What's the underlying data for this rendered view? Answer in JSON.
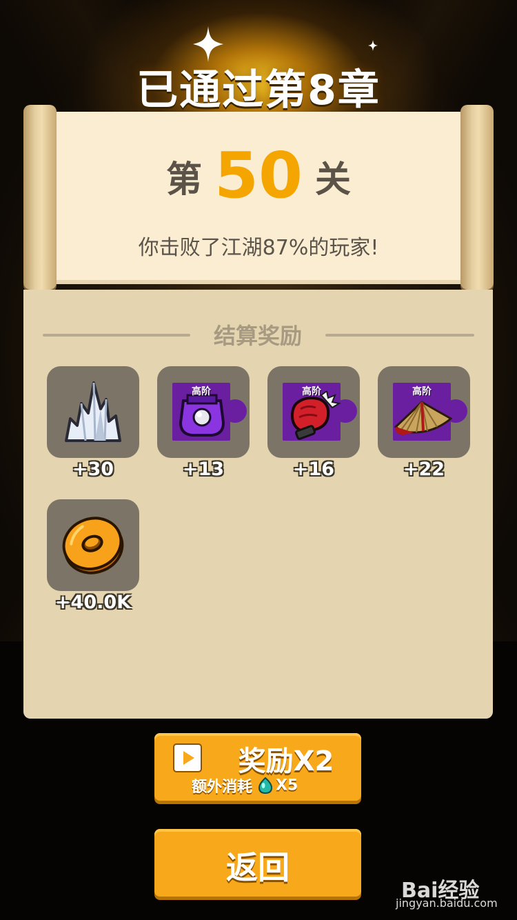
{
  "header": {
    "title": "已通过第8章"
  },
  "stage": {
    "prefix": "第",
    "number": "50",
    "suffix": "关",
    "result_text": "你击败了江湖87%的玩家!"
  },
  "rewards": {
    "section_title": "结算奖励",
    "items": [
      {
        "icon": "silver-crystal-icon",
        "amount": "+30"
      },
      {
        "icon": "purple-gauntlet-fragment-icon",
        "tier": "高阶",
        "amount": "+13"
      },
      {
        "icon": "red-fist-fragment-icon",
        "tier": "高阶",
        "amount": "+16"
      },
      {
        "icon": "bamboo-hat-fragment-icon",
        "tier": "高阶",
        "amount": "+22"
      },
      {
        "icon": "gold-coin-icon",
        "amount": "+40.0K"
      }
    ]
  },
  "buttons": {
    "double": {
      "label": "奖励X2",
      "cost_label": "额外消耗",
      "cost_qty": "X5",
      "cost_icon": "teal-drop-icon"
    },
    "return": {
      "label": "返回"
    }
  },
  "watermark": {
    "brand": "Bai经验",
    "site": "jingyan.baidu.com"
  },
  "colors": {
    "accent": "#f7a91b",
    "stage_number": "#f5a500",
    "panel": "#e4d5b0",
    "fragment": "#6a1fa1"
  }
}
